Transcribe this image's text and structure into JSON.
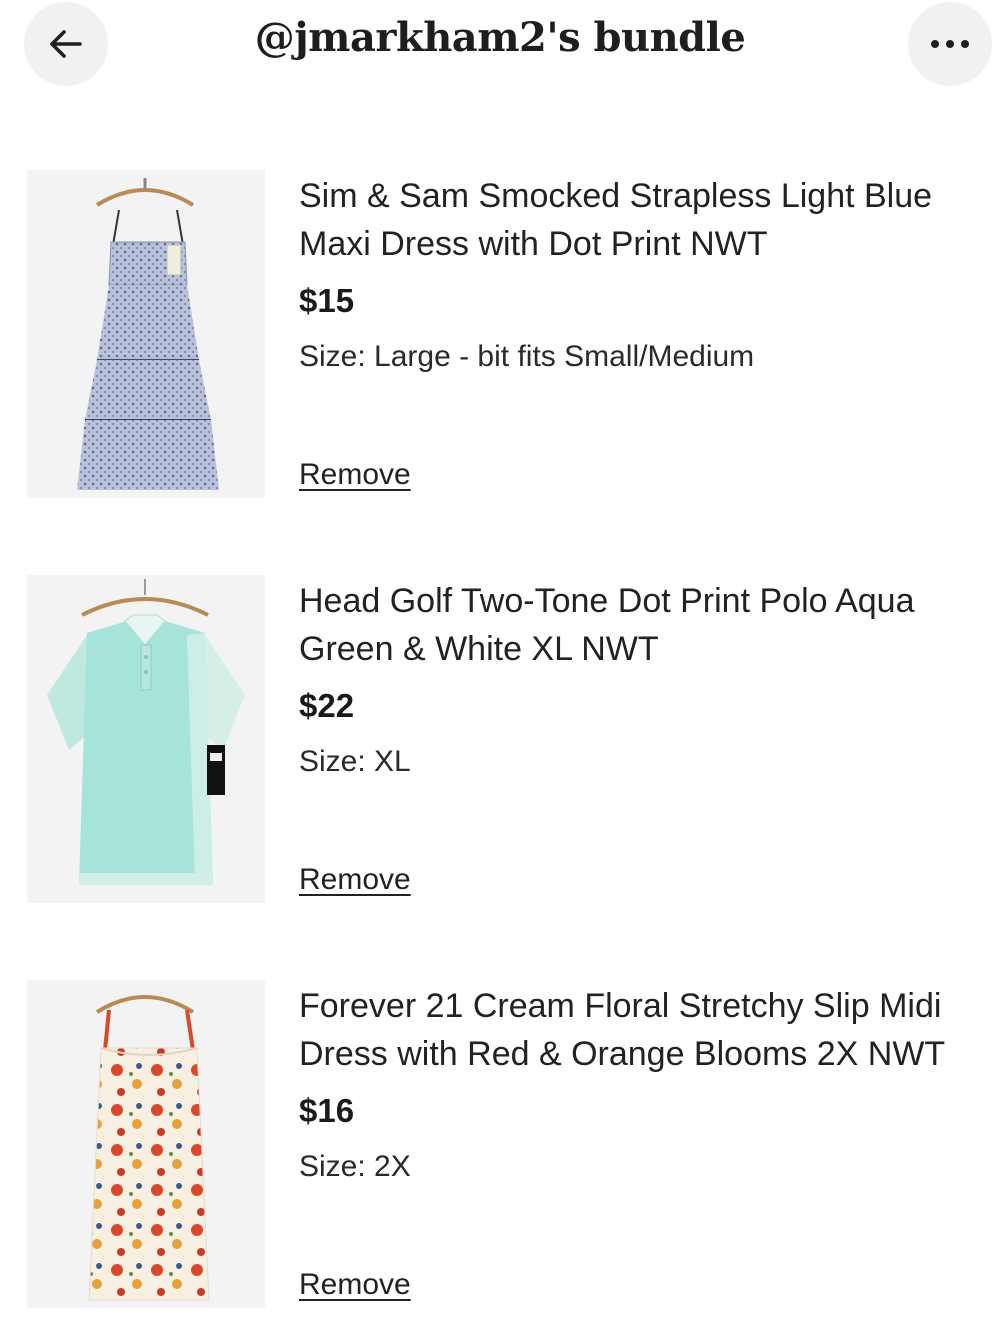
{
  "header": {
    "title": "@jmarkham2's bundle",
    "back_icon": "arrow-left-icon",
    "more_icon": "more-horizontal-icon"
  },
  "items": [
    {
      "title": "Sim & Sam Smocked Strapless Light Blue Maxi Dress with Dot Print NWT",
      "price": "$15",
      "size": "Size: Large - bit fits Small/Medium",
      "remove_label": "Remove",
      "image": "light-blue-dot-maxi-dress-on-hanger"
    },
    {
      "title": "Head Golf Two-Tone Dot Print Polo Aqua Green & White XL NWT",
      "price": "$22",
      "size": "Size: XL",
      "remove_label": "Remove",
      "image": "aqua-green-white-polo-on-hanger"
    },
    {
      "title": "Forever 21 Cream Floral Stretchy Slip Midi Dress with Red & Orange Blooms 2X NWT",
      "price": "$16",
      "size": "Size: 2X",
      "remove_label": "Remove",
      "image": "cream-floral-slip-dress-on-hanger"
    }
  ]
}
